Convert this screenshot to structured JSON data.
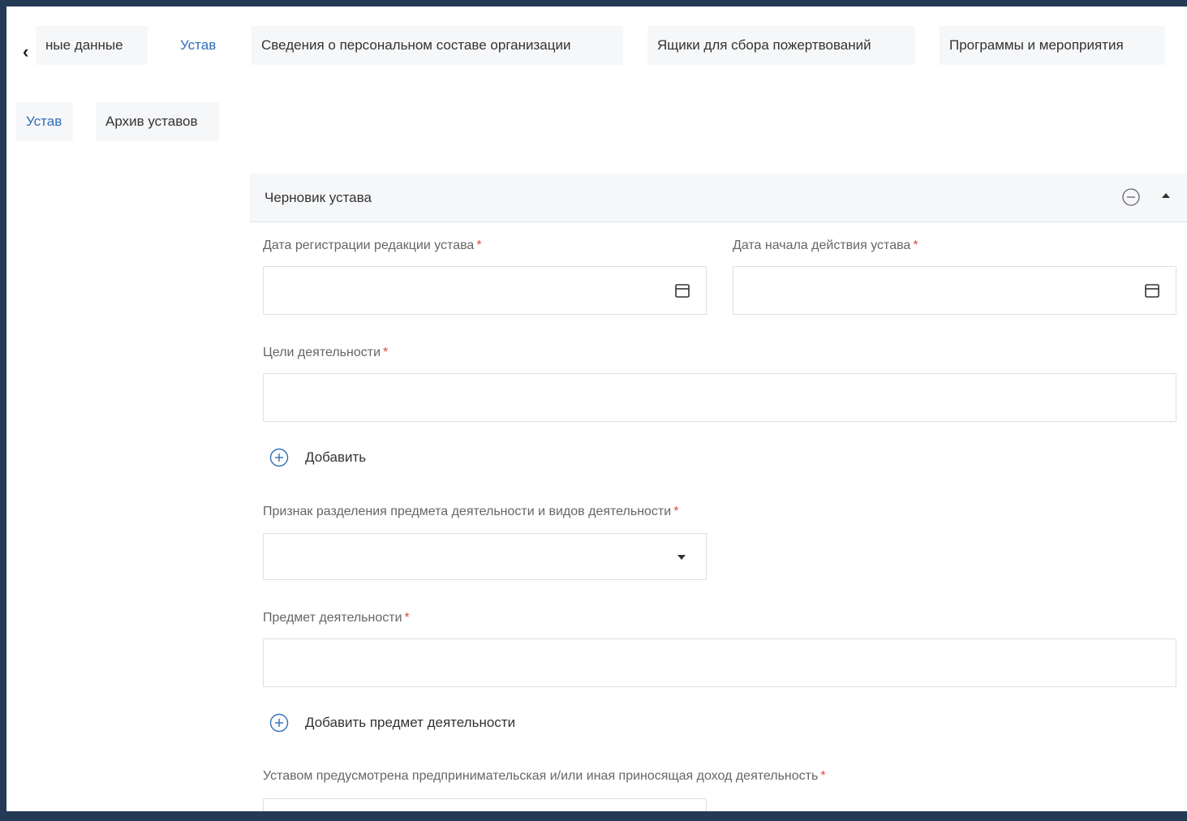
{
  "top_tabs": {
    "partial": "ные данные",
    "items": [
      "Устав",
      "Сведения о персональном составе организации",
      "Ящики для сбора пожертвований",
      "Программы и мероприятия"
    ]
  },
  "sub_tabs": [
    "Устав",
    "Архив уставов"
  ],
  "panel": {
    "title": "Черновик устава"
  },
  "form": {
    "reg_date_label": "Дата регистрации редакции устава",
    "start_date_label": "Дата начала действия устава",
    "goals_label": "Цели деятельности",
    "add_label": "Добавить",
    "sign_label": "Признак разделения предмета деятельности и видов деятельности",
    "subject_label": "Предмет деятельности",
    "add_subject_label": "Добавить предмет деятельности",
    "income_label": "Уставом предусмотрена предпринимательская и/или иная приносящая доход деятельность",
    "required_mark": "*"
  },
  "colors": {
    "accent": "#2f6fb6",
    "required": "#e2473f",
    "frame": "#253a57"
  },
  "icons": [
    "chevron-left-icon",
    "minus-circle-icon",
    "caret-up-icon",
    "calendar-icon",
    "caret-down-icon",
    "plus-circle-icon"
  ]
}
